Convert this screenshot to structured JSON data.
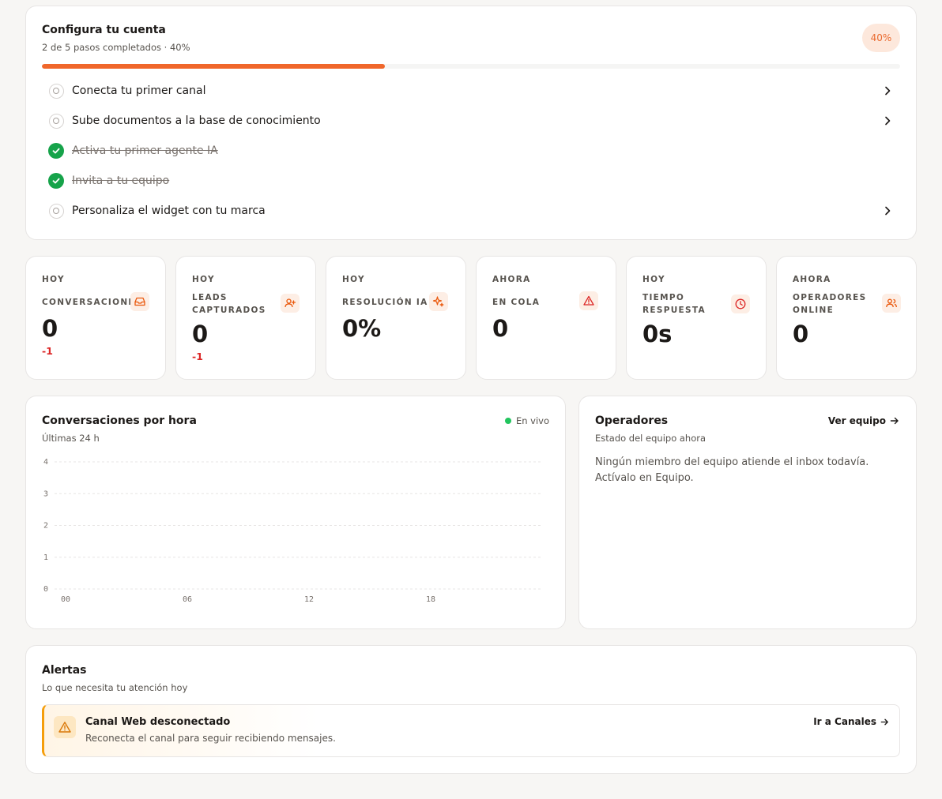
{
  "colors": {
    "accent": "#f0672b",
    "success": "#16a34a",
    "danger": "#dc2626",
    "warning": "#f59e0b",
    "live": "#22c55e"
  },
  "setup": {
    "title": "Configura tu cuenta",
    "subtitle": "2 de 5 pasos completados · 40%",
    "percent_label": "40%",
    "progress": 0.4,
    "steps": [
      {
        "label": "Conecta tu primer canal",
        "done": false
      },
      {
        "label": "Sube documentos a la base de conocimiento",
        "done": false
      },
      {
        "label": "Activa tu primer agente IA",
        "done": true
      },
      {
        "label": "Invita a tu equipo",
        "done": true
      },
      {
        "label": "Personaliza el widget con tu marca",
        "done": false
      }
    ]
  },
  "stats": [
    {
      "period": "Hoy",
      "label": "Conversaciones",
      "value": "0",
      "delta": "-1",
      "icon": "inbox-icon"
    },
    {
      "period": "Hoy",
      "label": "Leads capturados",
      "value": "0",
      "delta": "-1",
      "icon": "user-plus-icon"
    },
    {
      "period": "Hoy",
      "label": "Resolución IA",
      "value": "0%",
      "delta": "",
      "icon": "sparkles-icon"
    },
    {
      "period": "Ahora",
      "label": "En cola",
      "value": "0",
      "delta": "",
      "icon": "alert-triangle-icon"
    },
    {
      "period": "Hoy",
      "label": "Tiempo respuesta",
      "value": "0s",
      "delta": "",
      "icon": "clock-icon"
    },
    {
      "period": "Ahora",
      "label": "Operadores online",
      "value": "0",
      "delta": "",
      "icon": "users-icon"
    }
  ],
  "hourly": {
    "title": "Conversaciones por hora",
    "subtitle": "Últimas 24 h",
    "live_label": "En vivo"
  },
  "chart_data": {
    "type": "line",
    "x_ticks": [
      "00",
      "06",
      "12",
      "18"
    ],
    "y_ticks": [
      "0",
      "1",
      "2",
      "3",
      "4"
    ],
    "ylim": [
      0,
      4
    ],
    "grid": true,
    "series": [
      {
        "values": []
      }
    ]
  },
  "operators": {
    "title": "Operadores",
    "subtitle": "Estado del equipo ahora",
    "link_label": "Ver equipo",
    "empty_text": "Ningún miembro del equipo atiende el inbox todavía. Actívalo en Equipo."
  },
  "alerts": {
    "title": "Alertas",
    "subtitle": "Lo que necesita tu atención hoy",
    "items": [
      {
        "title": "Canal Web desconectado",
        "description": "Reconecta el canal para seguir recibiendo mensajes.",
        "action": "Ir a Canales"
      }
    ]
  }
}
